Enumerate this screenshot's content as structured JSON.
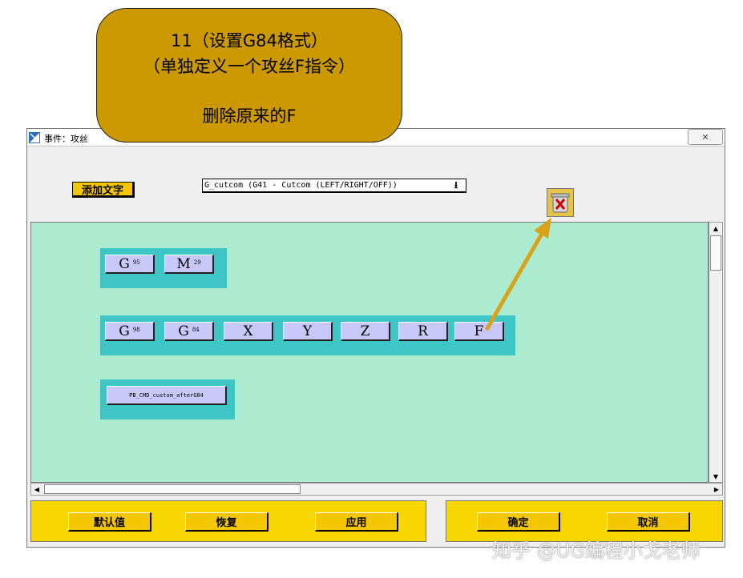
{
  "callout": {
    "line1": "11（设置G84格式）",
    "line2": "（单独定义一个攻丝F指令）",
    "line3": "删除原来的F"
  },
  "window": {
    "title": "事件：攻丝",
    "close_symbol": "✕"
  },
  "toolbar": {
    "add_text_label": "添加文字",
    "event_select_value": "G_cutcom (G41 - Cutcom (LEFT/RIGHT/OFF))",
    "dropdown_arrow": "⭳",
    "trash_icon": "trash-icon"
  },
  "blocks": {
    "row1": [
      {
        "letter": "G",
        "sub": "95"
      },
      {
        "letter": "M",
        "sub": "29"
      }
    ],
    "row2": [
      {
        "letter": "G",
        "sub": "98"
      },
      {
        "letter": "G",
        "sub": "84"
      },
      {
        "letter": "X",
        "sub": ""
      },
      {
        "letter": "Y",
        "sub": ""
      },
      {
        "letter": "Z",
        "sub": ""
      },
      {
        "letter": "R",
        "sub": ""
      },
      {
        "letter": "F",
        "sub": ""
      }
    ],
    "row3": [
      {
        "letter": "PB_CMD_custom_afterG84",
        "sub": ""
      }
    ]
  },
  "buttons": {
    "default_label": "默认值",
    "restore_label": "恢复",
    "apply_label": "应用",
    "ok_label": "确定",
    "cancel_label": "取消"
  },
  "watermark": "知乎 @UG编程小戈老师",
  "colors": {
    "callout_fill": "#cc9900",
    "canvas_bg": "#acebd0",
    "row_bg": "#3ec6c6",
    "block_bg": "#c8c8fa",
    "button_yellow": "#f4c700",
    "arrow": "#d9a21b"
  }
}
